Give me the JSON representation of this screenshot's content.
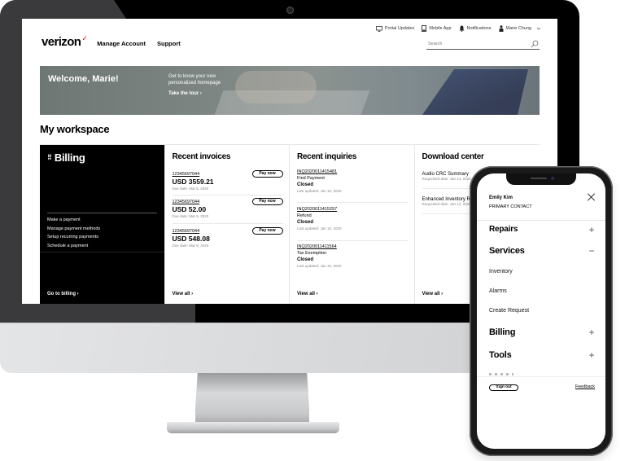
{
  "utility_bar": {
    "portal_updates": "Portal Updates",
    "mobile_app": "Mobile App",
    "notifications": "Notifications",
    "user_name": "Marie Chung"
  },
  "nav": {
    "logo": "verizon",
    "logo_check": "✓",
    "manage_account": "Manage Account",
    "support": "Support"
  },
  "search": {
    "placeholder": "Search"
  },
  "hero": {
    "welcome": "Welcome, Marie!",
    "copy": "Get to know your new personalized homepage",
    "cta": "Take the tour ›"
  },
  "workspace": {
    "title": "My workspace",
    "billing": {
      "title": "Billing",
      "grip": "⠿",
      "links": [
        "Make a payment",
        "Manage payment methods",
        "Setup recurring payments",
        "Schedule a payment"
      ],
      "cta": "Go to billing ›"
    },
    "invoices": {
      "title": "Recent invoices",
      "pay_label": "Pay now",
      "items": [
        {
          "number": "12345697044",
          "amount": "USD 3559.21",
          "due": "Due date: Mar 5, 2020"
        },
        {
          "number": "12345697044",
          "amount": "USD 52.00",
          "due": "Due date: Mar 9, 2020"
        },
        {
          "number": "12345697044",
          "amount": "USD 548.08",
          "due": "Due date: Mar 9, 2020"
        }
      ],
      "view_all": "View all ›"
    },
    "inquiries": {
      "title": "Recent inquiries",
      "items": [
        {
          "id": "INQ2020011415481",
          "type": "Find Payment",
          "status": "Closed",
          "updated": "Last updated: Jan 15, 2020"
        },
        {
          "id": "INQ2020011415297",
          "type": "Refund",
          "status": "Closed",
          "updated": "Last updated: Jan 15, 2020"
        },
        {
          "id": "INQ2020011411564",
          "type": "Tax Exemption",
          "status": "Closed",
          "updated": "Last updated: Jan 15, 2020"
        }
      ],
      "view_all": "View all ›"
    },
    "downloads": {
      "title": "Download center",
      "items": [
        {
          "name": "Audio CRC Summary",
          "date": "Requested date: Jan 14, 2020"
        },
        {
          "name": "Enhanced Inventory Report",
          "date": "Requested date: Jan 14, 2020"
        }
      ],
      "view_all": "View all ›"
    }
  },
  "phone_menu": {
    "contact_name": "Emily Kim",
    "contact_role": "PRIMARY CONTACT",
    "sections": [
      {
        "label": "Repairs",
        "state": "+"
      },
      {
        "label": "Services",
        "state": "−"
      },
      {
        "label": "Billing",
        "state": "+"
      },
      {
        "label": "Tools",
        "state": "+"
      }
    ],
    "service_items": [
      "Inventory",
      "Alarms",
      "Create Request"
    ],
    "sign_out": "Sign out",
    "feedback": "Feedback"
  },
  "colors": {
    "brand_red": "#ee0000",
    "billing_card_bg": "#000000"
  }
}
